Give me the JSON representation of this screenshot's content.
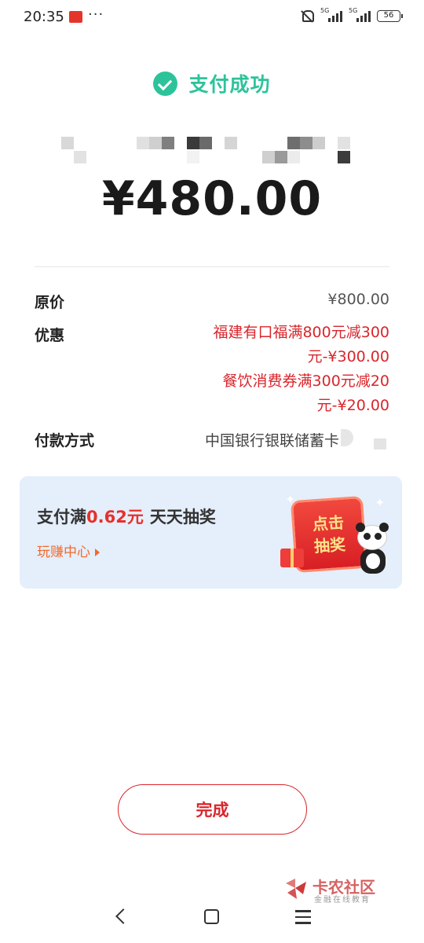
{
  "status_bar": {
    "time": "20:35",
    "more": "···",
    "network_1": "5G",
    "network_2": "5G",
    "battery": "56"
  },
  "header": {
    "title": "支付成功",
    "icon": "check-circle-icon",
    "accent_color": "#2cc39a"
  },
  "payment": {
    "amount": "¥480.00"
  },
  "details": {
    "original_price_label": "原价",
    "original_price_value": "¥800.00",
    "discount_label": "优惠",
    "discount_lines": [
      "福建有口福满800元减300",
      "元-¥300.00",
      "餐饮消费券满300元减20",
      "元-¥20.00"
    ],
    "discount_color": "#d9262c",
    "payment_method_label": "付款方式",
    "payment_method_value": "中国银行银联储蓄卡"
  },
  "promo": {
    "prefix": "支付满",
    "highlight": "0.62元",
    "suffix": "天天抽奖",
    "link": "玩赚中心",
    "draw_line1": "点击",
    "draw_line2": "抽奖",
    "highlight_color": "#e6312b"
  },
  "actions": {
    "done_label": "完成"
  },
  "watermark": {
    "title": "卡农社区",
    "subtitle": "金融在线教育"
  }
}
